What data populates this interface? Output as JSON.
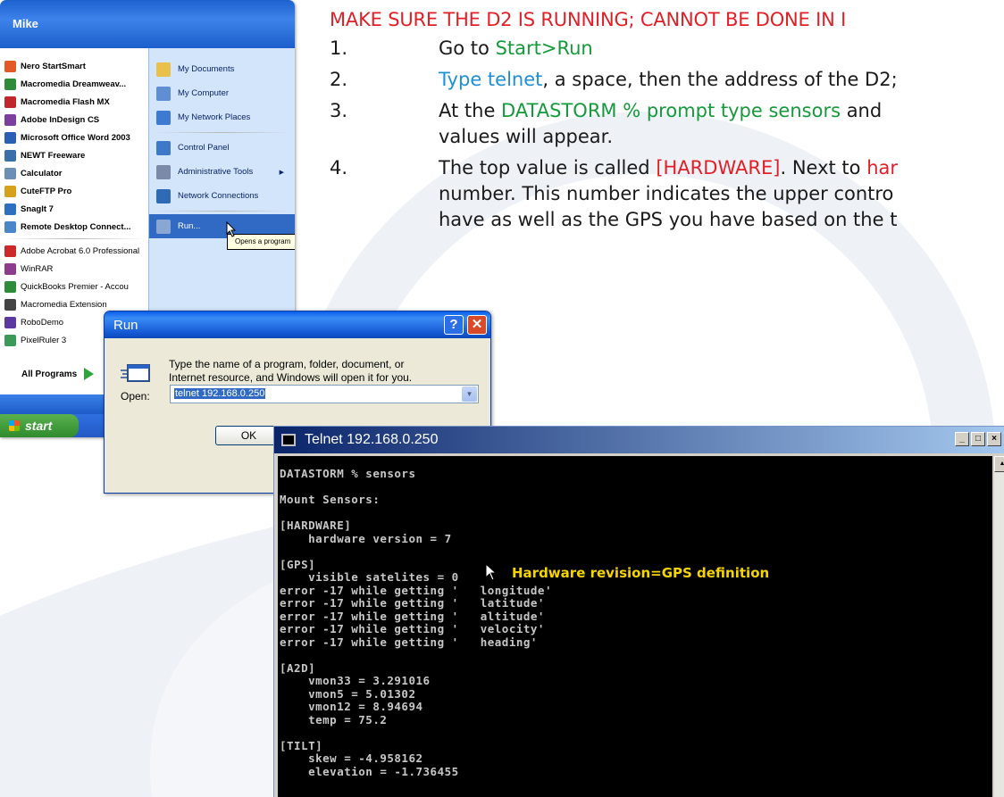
{
  "instructions": {
    "warning": "MAKE SURE THE D2 IS RUNNING; CANNOT BE DONE IN I",
    "steps": [
      {
        "num": "1.",
        "pre": "Go to ",
        "start_run": "Start>Run"
      },
      {
        "num": "2.",
        "type_telnet": "Type telnet",
        "rest": ", a space, then the address of the D2;"
      },
      {
        "num": "3.",
        "pre": "At the ",
        "prompt": "DATASTORM % prompt type sensors",
        "rest": " and",
        "line2": "values will appear."
      },
      {
        "num": "4.",
        "pre": "The top value is called ",
        "hardware": "[HARDWARE]",
        "mid": ". Next to ",
        "har": "har",
        "line2a": "number",
        "line2b": ". This number indicates the upper contro",
        "line3": "have as well as the GPS you have based on the t"
      }
    ]
  },
  "start_menu": {
    "user": "Mike",
    "left_items": [
      {
        "label": "Nero StartSmart",
        "color": "#e25b26"
      },
      {
        "label": "Macromedia Dreamweav...",
        "color": "#2f8a3b"
      },
      {
        "label": "Macromedia Flash MX",
        "color": "#c0262d"
      },
      {
        "label": "Adobe InDesign CS",
        "color": "#7b3f9e"
      },
      {
        "label": "Microsoft Office Word 2003",
        "color": "#2b5fb4"
      },
      {
        "label": "NEWT Freeware",
        "color": "#3b6fa8"
      },
      {
        "label": "Calculator",
        "color": "#6c8fb5"
      },
      {
        "label": "CuteFTP Pro",
        "color": "#d6a21e"
      },
      {
        "label": "SnagIt 7",
        "color": "#2f6fc0"
      },
      {
        "label": "Remote Desktop Connect...",
        "color": "#4b86c9"
      }
    ],
    "left_recent": [
      {
        "label": "Adobe Acrobat 6.0 Professional",
        "color": "#cc2a2a"
      },
      {
        "label": "WinRAR",
        "color": "#8d3c8d"
      },
      {
        "label": "QuickBooks Premier - Accou",
        "color": "#2f8a3b"
      },
      {
        "label": "Macromedia Extension",
        "color": "#444"
      },
      {
        "label": "RoboDemo",
        "color": "#5a3a9e"
      },
      {
        "label": "PixelRuler 3",
        "color": "#3b9a5a"
      }
    ],
    "all_programs": "All Programs",
    "right_items": [
      {
        "label": "My Documents",
        "color": "#e8c04a"
      },
      {
        "label": "My Computer",
        "color": "#5f8ed2"
      },
      {
        "label": "My Network Places",
        "color": "#3d7bd0"
      },
      {
        "label": "Control Panel",
        "color": "#3e78c8"
      },
      {
        "label": "Administrative Tools",
        "color": "#7a8aa8"
      },
      {
        "label": "Network Connections",
        "color": "#2f6ab5"
      },
      {
        "label": "Run...",
        "color": "#8aa6d2"
      }
    ],
    "tooltip": "Opens a program",
    "start_label": "start"
  },
  "run_dialog": {
    "title": "Run",
    "help": "?",
    "close": "✕",
    "description": "Type the name of a program, folder, document, or\nInternet resource, and Windows will open it for you.",
    "open_label": "Open:",
    "open_value": "telnet 192.168.0.250",
    "ok_label": "OK"
  },
  "telnet_window": {
    "title": "Telnet 192.168.0.250",
    "lines": [
      "DATASTORM % sensors",
      "",
      "Mount Sensors:",
      "",
      "[HARDWARE]",
      "    hardware version = 7",
      "",
      "[GPS]",
      "    visible satelites = 0",
      "error -17 while getting '   longitude'",
      "error -17 while getting '   latitude'",
      "error -17 while getting '   altitude'",
      "error -17 while getting '   velocity'",
      "error -17 while getting '   heading'",
      "",
      "[A2D]",
      "    vmon33 = 3.291016",
      "    vmon5 = 5.01302",
      "    vmon12 = 8.94694",
      "    temp = 75.2",
      "",
      "[TILT]",
      "    skew = -4.958162",
      "    elevation = -1.736455"
    ],
    "annotation": "Hardware revision=GPS definition"
  }
}
